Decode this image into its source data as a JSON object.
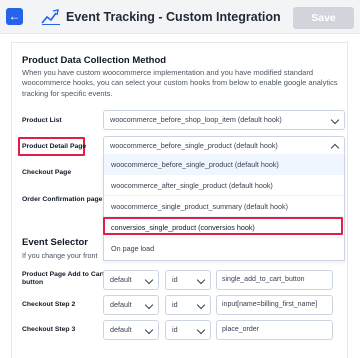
{
  "header": {
    "back_icon": "arrow-left-icon",
    "logo_icon": "analytics-chart-icon",
    "title": "Event Tracking - Custom Integration",
    "save_label": "Save"
  },
  "collection": {
    "title": "Product Data Collection Method",
    "description": "When you have custom woocommerce implementation and you have modified standard woocommerce hooks, you can select your custom hooks from below to enable google analytics tracking for specific events.",
    "rows": [
      {
        "label": "Product List",
        "value": "woocommerce_before_shop_loop_item (default hook)"
      },
      {
        "label": "Product Detail Page",
        "value": "woocommerce_before_single_product (default hook)"
      },
      {
        "label": "Checkout Page",
        "value": ""
      },
      {
        "label": "Order Confirmation page",
        "value": ""
      }
    ],
    "dropdown_options": [
      "woocommerce_before_single_product (default hook)",
      "woocommerce_after_single_product (default hook)",
      "woocommerce_single_product_summary (default hook)",
      "conversios_single_product (conversios hook)",
      "On page load"
    ]
  },
  "event_selector": {
    "title": "Event Selector",
    "description": "If you change your front",
    "rows": [
      {
        "label": "Product Page Add to Cart button",
        "type": "default",
        "selector": "id",
        "value": "single_add_to_cart_button"
      },
      {
        "label": "Checkout Step 2",
        "type": "default",
        "selector": "id",
        "value": "input[name=billing_first_name]"
      },
      {
        "label": "Checkout Step 3",
        "type": "default",
        "selector": "id",
        "value": "place_order"
      }
    ]
  },
  "colors": {
    "accent": "#2563eb",
    "highlight": "#e11d48",
    "save_disabled": "#d1d5db"
  }
}
